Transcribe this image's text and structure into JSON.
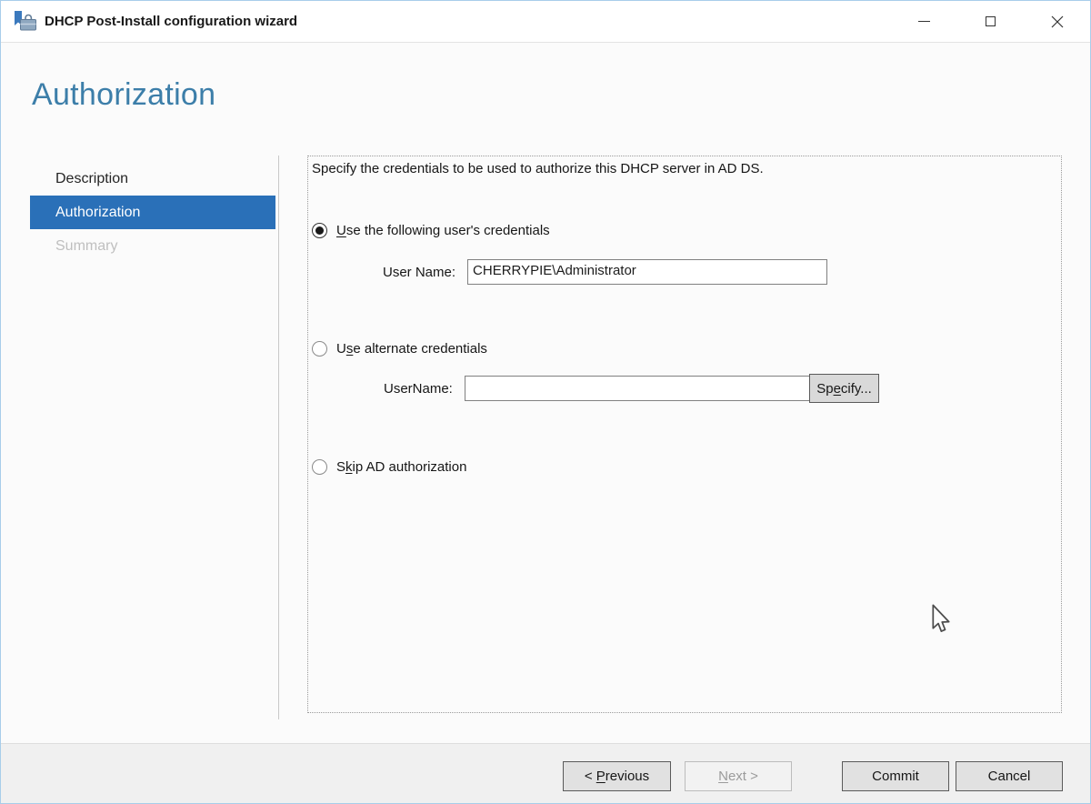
{
  "window": {
    "title": "DHCP Post-Install configuration wizard"
  },
  "page": {
    "heading": "Authorization"
  },
  "sidebar": {
    "items": [
      {
        "label": "Description",
        "state": "normal"
      },
      {
        "label": "Authorization",
        "state": "selected"
      },
      {
        "label": "Summary",
        "state": "disabled"
      }
    ]
  },
  "main": {
    "instruction": "Specify the credentials to be used to authorize this DHCP server in AD DS.",
    "radio_options": [
      {
        "pre": "",
        "accel": "U",
        "post": "se the following user's credentials",
        "selected": true
      },
      {
        "pre": "U",
        "accel": "s",
        "post": "e alternate credentials",
        "selected": false
      },
      {
        "pre": "S",
        "accel": "k",
        "post": "ip AD authorization",
        "selected": false
      }
    ],
    "user_name": {
      "label": "User Name:",
      "value": "CHERRYPIE\\Administrator"
    },
    "alt_user_name": {
      "label": "UserName:",
      "value": ""
    },
    "specify_button": {
      "pre": "Sp",
      "accel": "e",
      "post": "cify..."
    }
  },
  "footer": {
    "previous": {
      "pre": "< ",
      "accel": "P",
      "post": "revious",
      "enabled": true
    },
    "next": {
      "pre": "",
      "accel": "N",
      "post": "ext >",
      "enabled": false
    },
    "commit": {
      "label": "Commit",
      "enabled": true
    },
    "cancel": {
      "label": "Cancel",
      "enabled": true
    }
  },
  "colors": {
    "accent_blue": "#2a70b8",
    "heading_blue": "#3c7ea9",
    "window_border_blue": "#a8cdea"
  }
}
